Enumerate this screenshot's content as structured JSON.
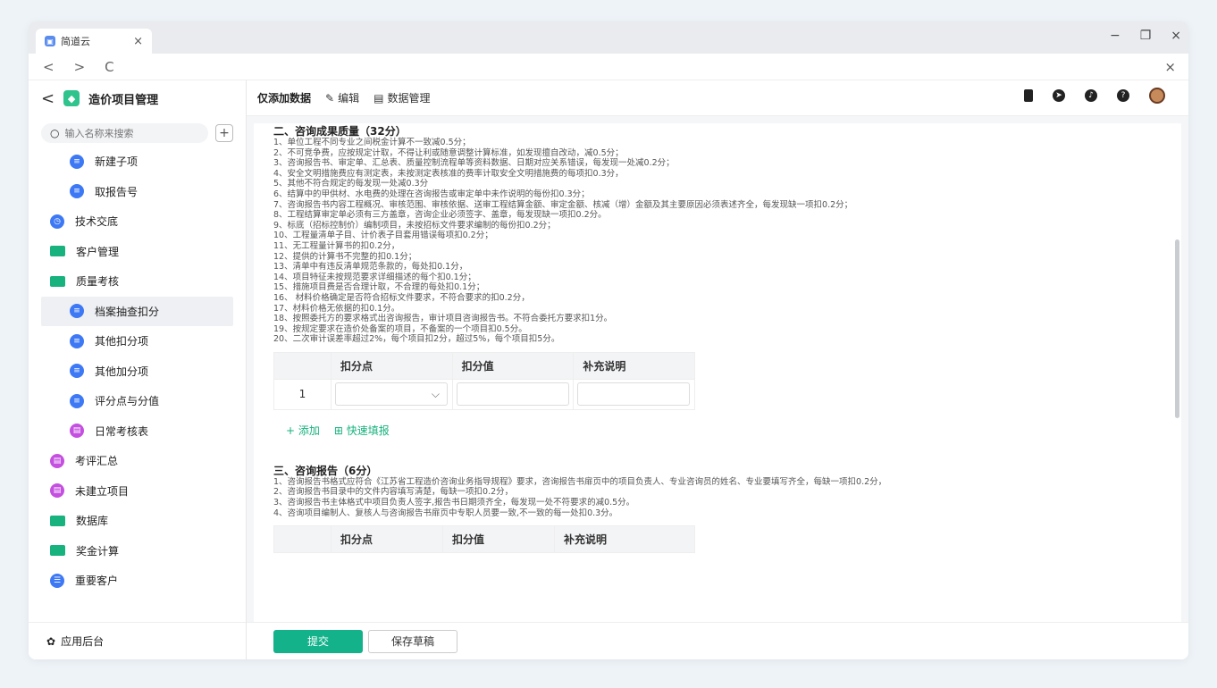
{
  "browser": {
    "tab_title": "简道云",
    "tab_close": "×",
    "win_minimize": "−",
    "win_restore": "❐",
    "win_close": "×",
    "nav_back": "<",
    "nav_forward": ">",
    "nav_reload": "C",
    "nav_close": "×"
  },
  "sidebar": {
    "back": "<",
    "app_title": "造价项目管理",
    "search_placeholder": "输入名称来搜索",
    "add": "+",
    "items": [
      {
        "label": "新建子项"
      },
      {
        "label": "取报告号"
      },
      {
        "label": "技术交底"
      },
      {
        "label": "客户管理"
      },
      {
        "label": "质量考核"
      },
      {
        "label": "档案抽查扣分"
      },
      {
        "label": "其他扣分项"
      },
      {
        "label": "其他加分项"
      },
      {
        "label": "评分点与分值"
      },
      {
        "label": "日常考核表"
      },
      {
        "label": "考评汇总"
      },
      {
        "label": "未建立项目"
      },
      {
        "label": "数据库"
      },
      {
        "label": "奖金计算"
      },
      {
        "label": "重要客户"
      }
    ],
    "footer": "应用后台"
  },
  "toolbar": {
    "title": "仅添加数据",
    "edit": "编辑",
    "data_manage": "数据管理"
  },
  "section2": {
    "title": "二、咨询成果质量（32分）",
    "rules": [
      "1、单位工程不同专业之间税金计算不一致减0.5分；",
      "2、不可竞争费，应按规定计取，不得让利或随意调整计算标准，如发现擅自改动，减0.5分；",
      "3、咨询报告书、审定单、汇总表、质量控制流程单等资料数据、日期对应关系错误，每发现一处减0.2分；",
      "4、安全文明措施费应有测定表，未按测定表核准的费率计取安全文明措施费的每项扣0.3分，",
      "5、其他不符合规定的每发现一处减0.3分",
      "6、结算中的甲供材、水电费的处理在咨询报告或审定单中未作说明的每份扣0.3分；",
      "7、咨询报告书内容工程概况、审核范围、审核依据、送审工程结算金额、审定金额、核减（增）金额及其主要原因必须表述齐全，每发现缺一项扣0.2分；",
      "8、工程结算审定单必须有三方盖章，咨询企业必须签字、盖章，每发现缺一项扣0.2分。",
      "9、标底（招标控制价）编制项目，未按招标文件要求编制的每份扣0.2分；",
      "10、工程量清单子目、计价表子目套用错误每项扣0.2分；",
      "11、无工程量计算书的扣0.2分，",
      "12、提供的计算书不完整的扣0.1分；",
      "13、清单中有违反清单规范条款的，每处扣0.1分，",
      "14、项目特征未按规范要求详细描述的每个扣0.1分；",
      "15、措施项目费是否合理计取，不合理的每处扣0.1分；",
      "16、 材料价格确定是否符合招标文件要求，不符合要求的扣0.2分，",
      "17、材料价格无依据的扣0.1分。",
      "18、按照委托方的要求格式出咨询报告，审计项目咨询报告书。不符合委托方要求扣1分。",
      "19、按规定要求在造价处备案的项目，不备案的一个项目扣0.5分。",
      "20、二次审计误差率超过2%，每个项目扣2分，超过5%，每个项目扣5分。"
    ],
    "table": {
      "headers": [
        "扣分点",
        "扣分值",
        "补充说明"
      ],
      "row_number": "1",
      "select_arrow": "⌵"
    },
    "add_label": "+ 添加",
    "quick_fill_label": "快速填报"
  },
  "section3": {
    "title": "三、咨询报告（6分）",
    "rules": [
      "1、咨询报告书格式应符合《江苏省工程造价咨询业务指导规程》要求，咨询报告书扉页中的项目负责人、专业咨询员的姓名、专业要填写齐全，每缺一项扣0.2分，",
      "2、咨询报告书目录中的文件内容填写清楚，每缺一项扣0.2分，",
      "3、咨询报告书主体格式中项目负责人签字,报告书日期须齐全，每发现一处不符要求的减0.5分。",
      "4、咨询项目编制人、复核人与咨询报告书扉页中专职人员要一致,不一致的每一处扣0.3分。"
    ],
    "table": {
      "headers": [
        "扣分点",
        "扣分值",
        "补充说明"
      ]
    }
  },
  "footer": {
    "submit": "提交",
    "save_draft": "保存草稿"
  },
  "colors": {
    "accent": "#13b28a",
    "blue_icon": "#3d78f5",
    "purple_icon": "#c44fe0",
    "folder": "#17b27d"
  }
}
